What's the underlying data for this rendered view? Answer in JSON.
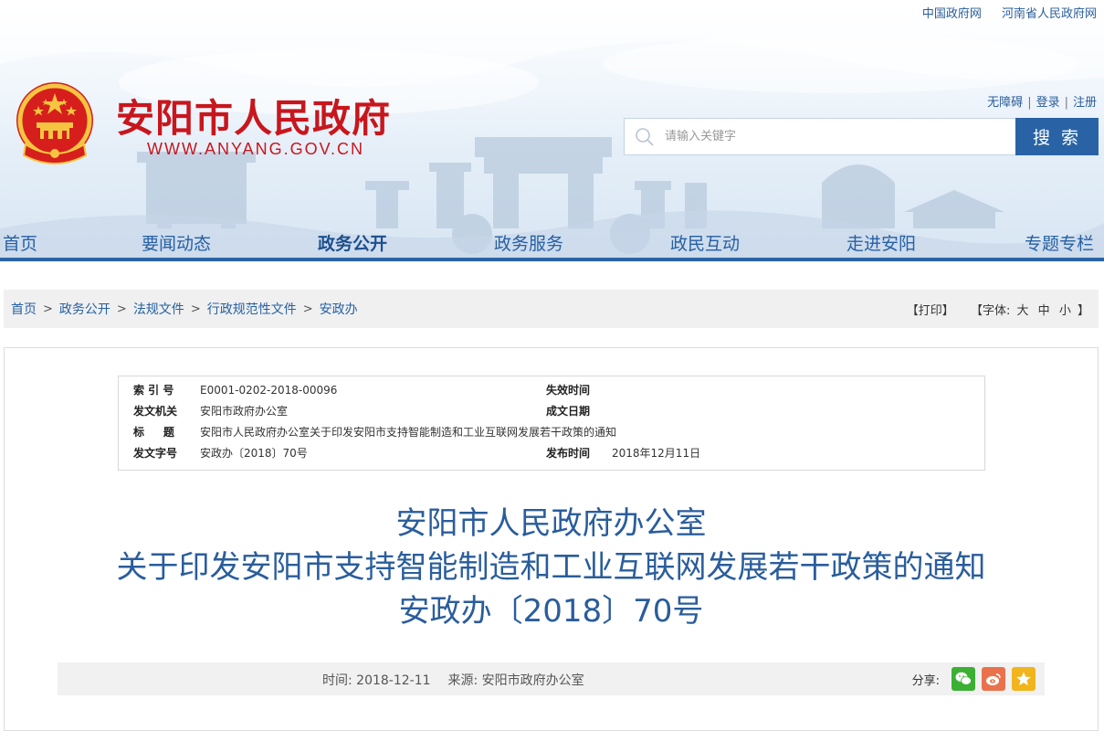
{
  "top_links": [
    "中国政府网",
    "河南省人民政府网"
  ],
  "site": {
    "name": "安阳市人民政府",
    "url": "WWW.ANYANG.GOV.CN"
  },
  "account_links": [
    "无障碍",
    "登录",
    "注册"
  ],
  "search": {
    "placeholder": "请输入关键字",
    "button_label": "搜 索"
  },
  "nav": {
    "items": [
      "首页",
      "要闻动态",
      "政务公开",
      "政务服务",
      "政民互动",
      "走进安阳",
      "专题专栏"
    ],
    "active": "政务公开"
  },
  "breadcrumb": {
    "items": [
      "首页",
      "政务公开",
      "法规文件",
      "行政规范性文件",
      "安政办"
    ],
    "separator": ">"
  },
  "tools": {
    "print_label": "【打印】",
    "font_label": "【字体:",
    "font_sizes": [
      "大",
      "中",
      "小"
    ],
    "font_close": "】"
  },
  "meta": {
    "index_label": "索 引 号",
    "index_value": "E0001-0202-2018-00096",
    "expire_label": "失效时间",
    "expire_value": "",
    "issuer_label": "发文机关",
    "issuer_value": "安阳市政府办公室",
    "written_label": "成文日期",
    "written_value": "",
    "title_label": "标     题",
    "title_value": "安阳市人民政府办公室关于印发安阳市支持智能制造和工业互联网发展若干政策的通知",
    "docno_label": "发文字号",
    "docno_value": "安政办〔2018〕70号",
    "publish_label": "发布时间",
    "publish_value": "2018年12月11日"
  },
  "article": {
    "title_line1": "安阳市人民政府办公室",
    "title_line2": "关于印发安阳市支持智能制造和工业互联网发展若干政策的通知",
    "title_line3": "安政办〔2018〕70号",
    "time_label": "时间:",
    "time_value": "2018-12-11",
    "source_label": "来源:",
    "source_value": "安阳市政府办公室",
    "share_label": "分享:"
  },
  "colors": {
    "brand_red": "#c8161d",
    "primary_blue": "#2a63a5",
    "title_blue": "#2a5d9c",
    "wechat_green": "#3cb034",
    "weibo_orange": "#e9724c",
    "qzone_yellow": "#f2b41c"
  }
}
